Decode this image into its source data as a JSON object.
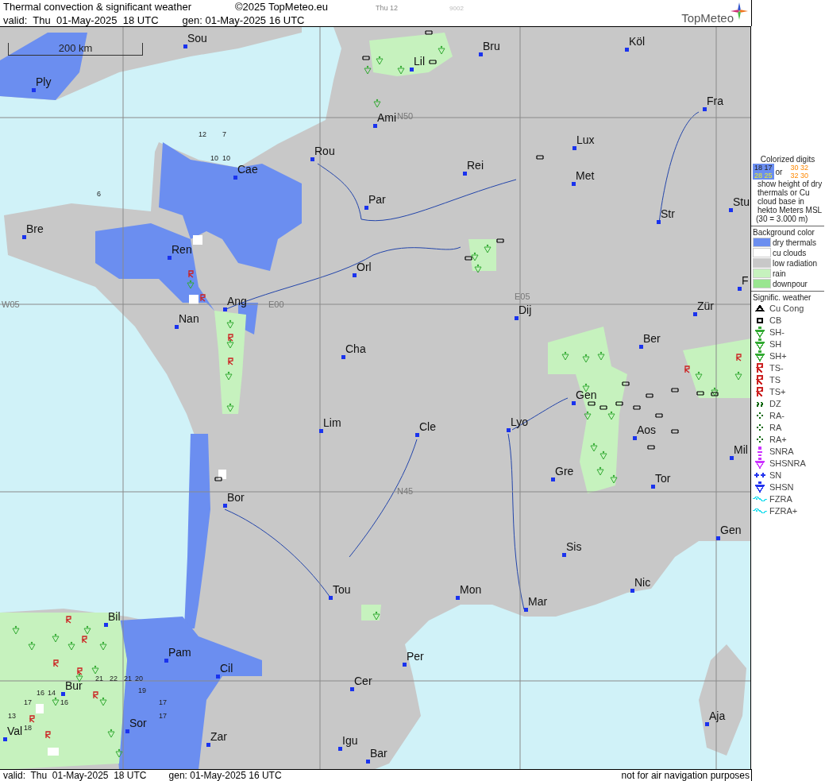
{
  "header": {
    "title": "Thermal convection & significant weather",
    "copyright": "©2025 TopMeteo.eu",
    "run_label": "Thu 12",
    "code": "9002",
    "valid": "valid:  Thu  01-May-2025  18 UTC",
    "generated": "gen: 01-May-2025 16 UTC",
    "logo": "TopMeteo"
  },
  "map": {
    "scale": "200 km",
    "grid_labels": [
      "N50",
      "W05",
      "E00",
      "E05",
      "N45"
    ],
    "cities": [
      "Sou",
      "Ply",
      "Lil",
      "Bru",
      "Köl",
      "Ami",
      "Fra",
      "Rou",
      "Cae",
      "Rei",
      "Lux",
      "Met",
      "Par",
      "Stu",
      "Bre",
      "Str",
      "Ren",
      "Orl",
      "Ang",
      "Nan",
      "Dij",
      "Zür",
      "Ber",
      "Cha",
      "Gen",
      "Lim",
      "Cle",
      "Lyo",
      "Aos",
      "Mil",
      "Gre",
      "Tor",
      "Bor",
      "Gen",
      "Sis",
      "Nic",
      "Tou",
      "Mon",
      "Mar",
      "Bil",
      "Pam",
      "Per",
      "Cil",
      "Cer",
      "Bur",
      "Sor",
      "Aja",
      "Val",
      "Zar",
      "Igu",
      "Bar",
      "F"
    ],
    "digits": [
      "12",
      "7",
      "10",
      "10",
      "6",
      "21",
      "22",
      "21",
      "20",
      "17",
      "17",
      "19",
      "16",
      "14",
      "17",
      "16",
      "13",
      "18"
    ]
  },
  "legend": {
    "digits_title": "Colorized digits",
    "sample_blue": [
      "18 17",
      "28 25"
    ],
    "or": "or",
    "sample_orange": [
      "30 32",
      "32 30"
    ],
    "digits_note": "show height of dry thermals or Cu cloud base in hekto Meters MSL",
    "digits_example": "(30 = 3.000 m)",
    "background_title": "Background color",
    "backgrounds": [
      {
        "label": "dry thermals",
        "color": "#6b8ef0"
      },
      {
        "label": "cu clouds",
        "color": "#ffffff"
      },
      {
        "label": "low radiation",
        "color": "#c8c8c8"
      },
      {
        "label": "rain",
        "color": "#c6f2be"
      },
      {
        "label": "downpour",
        "color": "#99e690"
      }
    ],
    "weather_title": "Signific. weather",
    "weather": [
      {
        "label": "Cu Cong",
        "kind": "cucong",
        "color": "#000000"
      },
      {
        "label": "CB",
        "kind": "cb",
        "color": "#000000"
      },
      {
        "label": "SH-",
        "kind": "shower",
        "color": "#33aa33"
      },
      {
        "label": "SH",
        "kind": "shower",
        "color": "#33aa33"
      },
      {
        "label": "SH+",
        "kind": "shower",
        "color": "#33aa33"
      },
      {
        "label": "TS-",
        "kind": "thunder",
        "color": "#cc2222"
      },
      {
        "label": "TS",
        "kind": "thunder",
        "color": "#cc2222"
      },
      {
        "label": "TS+",
        "kind": "thunder",
        "color": "#cc2222"
      },
      {
        "label": "DZ",
        "kind": "drizzle",
        "color": "#006400"
      },
      {
        "label": "RA-",
        "kind": "rain",
        "color": "#006400"
      },
      {
        "label": "RA",
        "kind": "rain",
        "color": "#006400"
      },
      {
        "label": "RA+",
        "kind": "rain",
        "color": "#006400"
      },
      {
        "label": "SNRA",
        "kind": "snowrain",
        "color": "#cc33ff"
      },
      {
        "label": "SHSNRA",
        "kind": "shower",
        "color": "#cc33ff"
      },
      {
        "label": "SN",
        "kind": "snow",
        "color": "#2233ee"
      },
      {
        "label": "SHSN",
        "kind": "shower",
        "color": "#2233ee"
      },
      {
        "label": "FZRA",
        "kind": "freezing",
        "color": "#22ddee"
      },
      {
        "label": "FZRA+",
        "kind": "freezing",
        "color": "#22ddee"
      }
    ]
  },
  "footer": {
    "valid": "valid:  Thu  01-May-2025  18 UTC",
    "generated": "gen: 01-May-2025 16 UTC",
    "notice": "not for air navigation purposes"
  }
}
